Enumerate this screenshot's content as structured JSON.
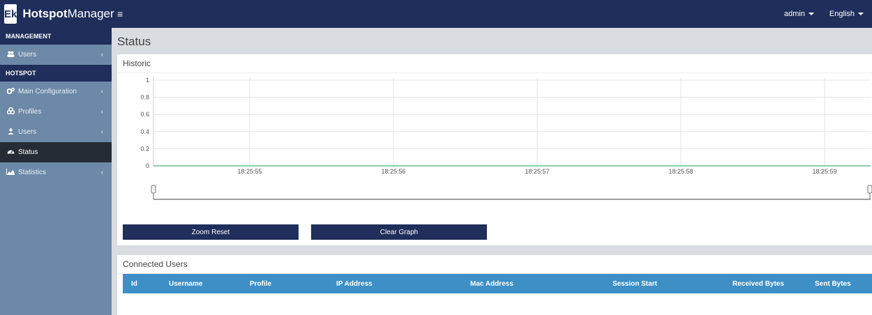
{
  "app": {
    "logo_text": "Ek",
    "name_bold": "Hotspot",
    "name_rest": "Manager",
    "menu_icon": "hamburger-icon"
  },
  "topbar": {
    "user_menu": "admin",
    "language_menu": "English"
  },
  "sidebar": {
    "sections": [
      {
        "header": "MANAGEMENT",
        "items": [
          {
            "label": "Users",
            "icon": "users-icon",
            "chevron": true
          }
        ]
      },
      {
        "header": "HOTSPOT",
        "items": [
          {
            "label": "Main Configuration",
            "icon": "gears-icon",
            "chevron": true
          },
          {
            "label": "Profiles",
            "icon": "profiles-icon",
            "chevron": true
          },
          {
            "label": "Users",
            "icon": "user-icon",
            "chevron": true
          },
          {
            "label": "Status",
            "icon": "dashboard-icon",
            "chevron": false,
            "active": true
          },
          {
            "label": "Statistics",
            "icon": "area-chart-icon",
            "chevron": true
          }
        ]
      }
    ]
  },
  "page": {
    "title": "Status"
  },
  "historic": {
    "heading": "Historic",
    "zoom_reset_label": "Zoom Reset",
    "clear_graph_label": "Clear Graph"
  },
  "chart_data": {
    "type": "line",
    "title": "",
    "xlabel": "",
    "ylabel": "",
    "ylim": [
      0,
      1
    ],
    "y_ticks": [
      "0",
      "0.2",
      "0.4",
      "0.6",
      "0.8",
      "1"
    ],
    "x_ticks": [
      "18:25:55",
      "18:25:56",
      "18:25:57",
      "18:25:58",
      "18:25:59"
    ],
    "series": [
      {
        "color": "#4caf7d",
        "x": [
          "18:25:55",
          "18:25:56",
          "18:25:57",
          "18:25:58",
          "18:25:59"
        ],
        "values": [
          0,
          0,
          0,
          0,
          0
        ]
      }
    ],
    "grid": true,
    "navigator": true
  },
  "connected_users": {
    "heading": "Connected Users",
    "columns": [
      "Id",
      "Username",
      "Profile",
      "IP Address",
      "Mac Address",
      "Session Start",
      "Received Bytes",
      "Sent Bytes"
    ],
    "rows": []
  }
}
